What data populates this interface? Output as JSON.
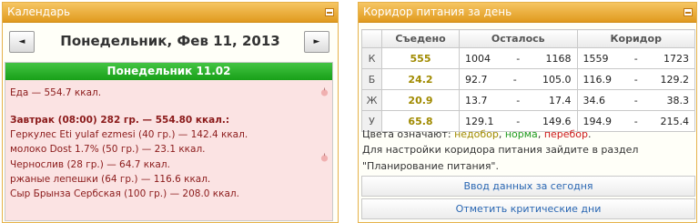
{
  "calendar": {
    "title": "Календарь",
    "prev_label": "◄",
    "next_label": "►",
    "date_title": "Понедельник, Фев 11, 2013",
    "day_header": "Понедельник 11.02",
    "lines": [
      "Еда — 554.7 ккал.",
      "Завтрак (08:00) 282 гр. — 554.80 ккал.:",
      "Геркулес Eti yulaf ezmesi (40 гр.) — 142.4 ккал.",
      "молоко Dost 1.7% (50 гр.) — 23.1 ккал.",
      "Чернослив (28 гр.) — 64.7 ккал.",
      "ржаные лепешки (64 гр.) — 116.6 ккал.",
      "Сыр Брынза Сербская (100 гр.) — 208.0 ккал."
    ]
  },
  "corridor": {
    "title": "Коридор питания за день",
    "headers": [
      "",
      "Съедено",
      "Осталось",
      "Коридор"
    ],
    "rows": [
      {
        "label": "К",
        "eaten": "555",
        "left_min": "1004",
        "left_max": "1168",
        "corr_min": "1559",
        "corr_max": "1723"
      },
      {
        "label": "Б",
        "eaten": "24.2",
        "left_min": "92.7",
        "left_max": "105.0",
        "corr_min": "116.9",
        "corr_max": "129.2"
      },
      {
        "label": "Ж",
        "eaten": "20.9",
        "left_min": "13.7",
        "left_max": "17.4",
        "corr_min": "34.6",
        "corr_max": "38.3"
      },
      {
        "label": "У",
        "eaten": "65.8",
        "left_min": "129.1",
        "left_max": "149.6",
        "corr_min": "194.9",
        "corr_max": "215.4"
      }
    ],
    "dash": "-",
    "legend_prefix": "Цвета означают: ",
    "legend_under": "недобор",
    "legend_sep": ", ",
    "legend_norm": "норма",
    "legend_over": "перебор",
    "legend_end": ".",
    "info_line1": "Для настройки коридора питания зайдите в раздел",
    "info_line2": "\"Планирование питания\".",
    "btn_enter": "Ввод данных за сегодня",
    "btn_critical": "Отметить критические дни",
    "colors": {
      "under": "#a08a00",
      "norm": "#1f9a1f",
      "over": "#cc1a1a",
      "header": "#e19a1f"
    }
  }
}
